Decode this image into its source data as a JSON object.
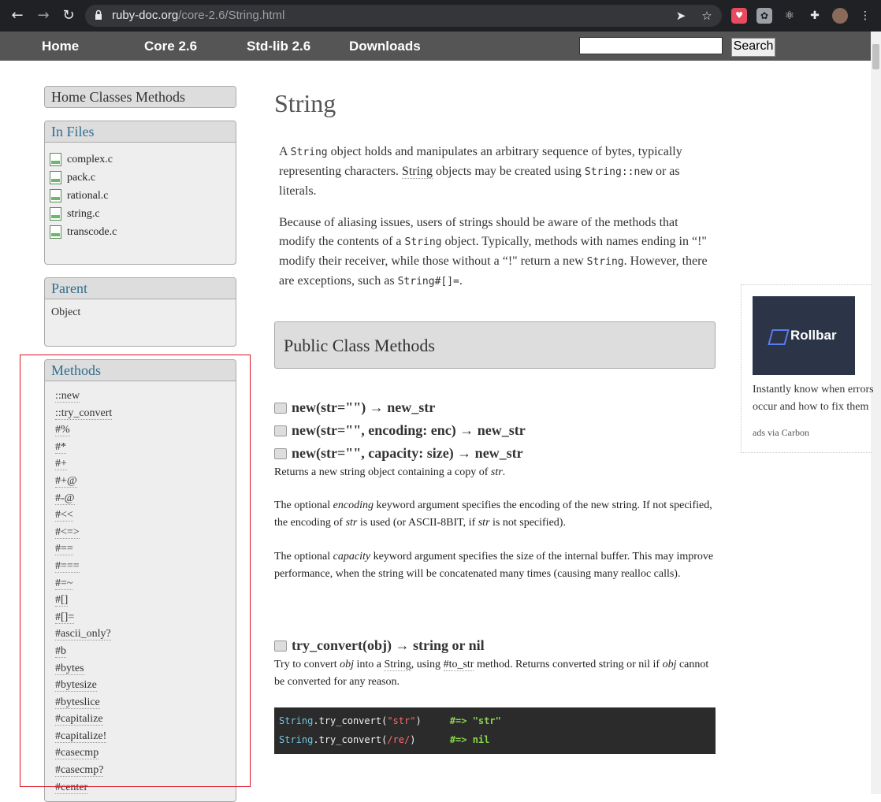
{
  "browser": {
    "url_domain": "ruby-doc.org",
    "url_path": "/core-2.6/String.html"
  },
  "topnav": {
    "home": "Home",
    "core": "Core 2.6",
    "stdlib": "Std-lib 2.6",
    "downloads": "Downloads",
    "search_button": "Search",
    "search_value": ""
  },
  "sidebar": {
    "home_classes_methods": "Home Classes Methods",
    "in_files_title": "In Files",
    "files": [
      "complex.c",
      "pack.c",
      "rational.c",
      "string.c",
      "transcode.c"
    ],
    "parent_title": "Parent",
    "parent": "Object",
    "methods_title": "Methods",
    "methods": [
      "::new",
      "::try_convert",
      "#%",
      "#*",
      "#+",
      "#+@",
      "#-@",
      "#<<",
      "#<=>",
      "#==",
      "#===",
      "#=~",
      "#[]",
      "#[]=",
      "#ascii_only?",
      "#b",
      "#bytes",
      "#bytesize",
      "#byteslice",
      "#capitalize",
      "#capitalize!",
      "#casecmp",
      "#casecmp?",
      "#center"
    ]
  },
  "main": {
    "title": "String",
    "p1": {
      "a": "A ",
      "code1": "String",
      "b": " object holds and manipulates an arbitrary sequence of bytes, typically representing characters. ",
      "link": "String",
      "c": " objects may be created using ",
      "code2": "String::new",
      "d": " or as literals."
    },
    "p2": {
      "a": "Because of aliasing issues, users of strings should be aware of the methods that modify the contents of a ",
      "code1": "String",
      "b": " object. Typically, methods with names ending in “!\" modify their receiver, while those without a “!\" return a new ",
      "code2": "String",
      "c": ". However, there are exceptions, such as ",
      "code3": "String#[]=",
      "d": "."
    },
    "section_title": "Public Class Methods",
    "signatures": [
      "new(str=\"\") → new_str",
      "new(str=\"\", encoding: enc) → new_str",
      "new(str=\"\", capacity: size) → new_str"
    ],
    "new_desc1": {
      "a": "Returns a new string object containing a copy of ",
      "em": "str",
      "b": "."
    },
    "new_desc2": {
      "a": "The optional ",
      "em1": "encoding",
      "b": " keyword argument specifies the encoding of the new string. If not specified, the encoding of ",
      "em2": "str",
      "c": " is used (or ASCII-8BIT, if ",
      "em3": "str",
      "d": " is not specified)."
    },
    "new_desc3": {
      "a": "The optional ",
      "em": "capacity",
      "b": " keyword argument specifies the size of the internal buffer. This may improve performance, when the string will be concatenated many times (causing many realloc calls)."
    },
    "try_convert_sig": "try_convert(obj) → string or nil",
    "try_desc": {
      "a": "Try to convert ",
      "em1": "obj",
      "b": " into a ",
      "link1": "String",
      "c": ", using ",
      "link2": "#to_str",
      "d": " method. Returns converted string or nil if ",
      "em2": "obj",
      "e": " cannot be converted for any reason."
    },
    "code_lines": [
      {
        "cls": "String",
        "dot": ".",
        "meth": "try_convert",
        "open": "(",
        "arg": "\"str\"",
        "close": ")",
        "pad": "     ",
        "res": "#=> \"str\""
      },
      {
        "cls": "String",
        "dot": ".",
        "meth": "try_convert",
        "open": "(",
        "arg": "/re/",
        "close": ")",
        "pad": "      ",
        "res": "#=> nil"
      }
    ]
  },
  "ad": {
    "brand": "Rollbar",
    "text1": "Instantly know when errors",
    "text2": "occur and how to fix them",
    "via": "ads via Carbon"
  }
}
